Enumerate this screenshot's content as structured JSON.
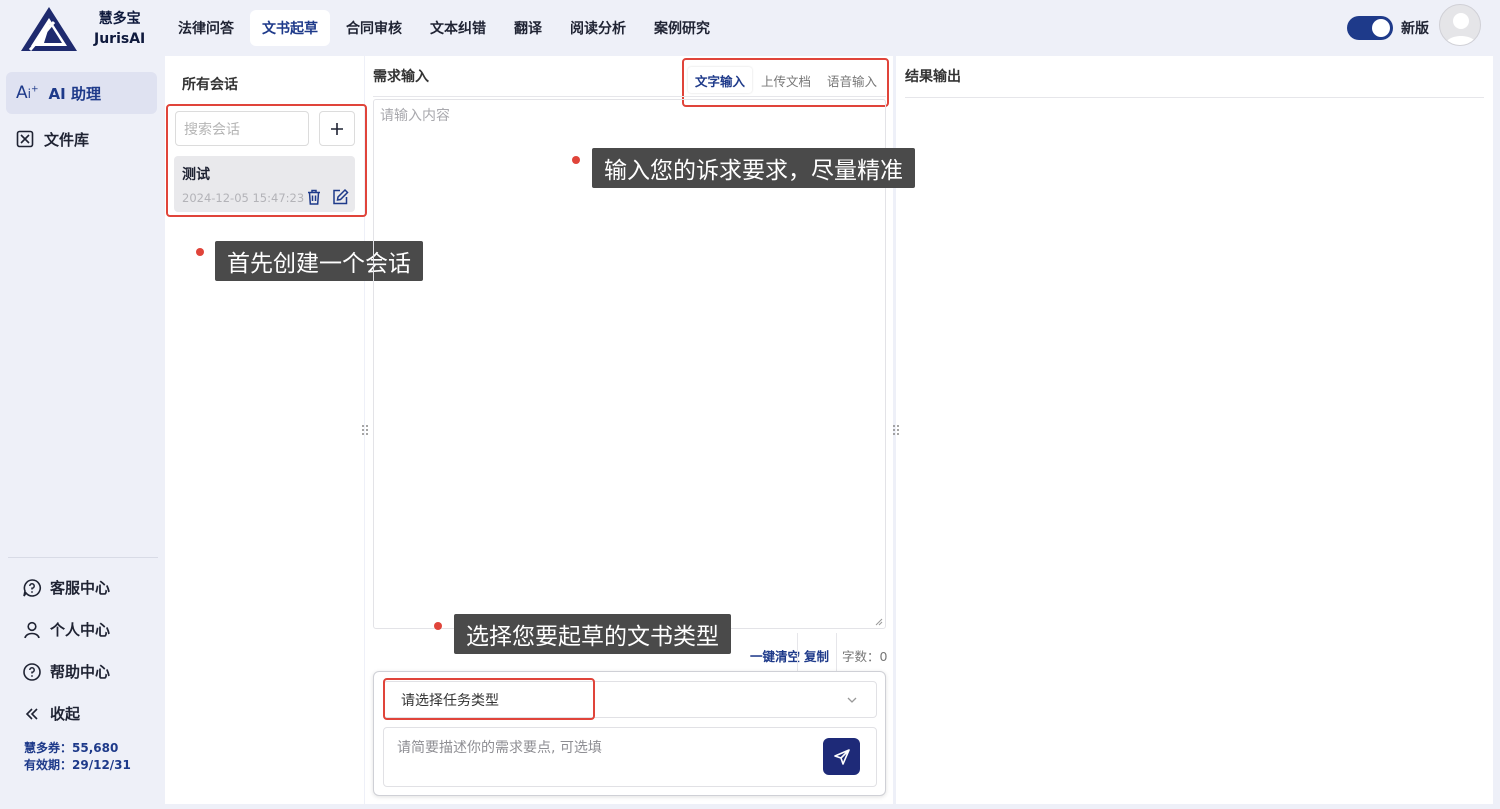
{
  "brand": {
    "name_cn": "慧多宝",
    "name_en": "JurisAI"
  },
  "nav": [
    {
      "label": "法律问答"
    },
    {
      "label": "文书起草"
    },
    {
      "label": "合同审核"
    },
    {
      "label": "文本纠错"
    },
    {
      "label": "翻译"
    },
    {
      "label": "阅读分析"
    },
    {
      "label": "案例研究"
    }
  ],
  "nav_active": "文书起草",
  "header": {
    "version_label": "新版",
    "version_toggle_on": true
  },
  "sidebar": {
    "items": [
      {
        "label": "AI 助理",
        "icon": "ai-sparkle-icon"
      },
      {
        "label": "文件库",
        "icon": "file-box-icon"
      }
    ],
    "bottom": [
      {
        "label": "客服中心",
        "icon": "chat-question-icon"
      },
      {
        "label": "个人中心",
        "icon": "user-icon"
      },
      {
        "label": "帮助中心",
        "icon": "help-circle-icon"
      },
      {
        "label": "收起",
        "icon": "double-chevron-left-icon"
      }
    ],
    "credits": {
      "label": "慧多券：",
      "value": "55,680"
    },
    "validity": {
      "label": "有效期：",
      "value": "29/12/31"
    }
  },
  "conversations": {
    "title": "所有会话",
    "search_placeholder": "搜索会话",
    "items": [
      {
        "name": "测试",
        "time": "2024-12-05 15:47:23"
      }
    ]
  },
  "request": {
    "title": "需求输入",
    "tabs": [
      {
        "label": "文字输入"
      },
      {
        "label": "上传文档"
      },
      {
        "label": "语音输入"
      }
    ],
    "placeholder": "请输入内容",
    "actions": {
      "clear": "一键清空",
      "copy": "复制",
      "wordcount_label": "字数：",
      "wordcount_value": "0"
    },
    "task_select_placeholder": "请选择任务类型",
    "desc_placeholder": "请简要描述你的需求要点, 可选填"
  },
  "result": {
    "title": "结果输出"
  },
  "tooltips": {
    "create": "首先创建一个会话",
    "input": "输入您的诉求要求，尽量精准",
    "select": "选择您要起草的文书类型"
  },
  "colors": {
    "accent": "#1e3a8a",
    "highlight": "#e0443a",
    "tooltip_bg": "#4a4a4a"
  }
}
